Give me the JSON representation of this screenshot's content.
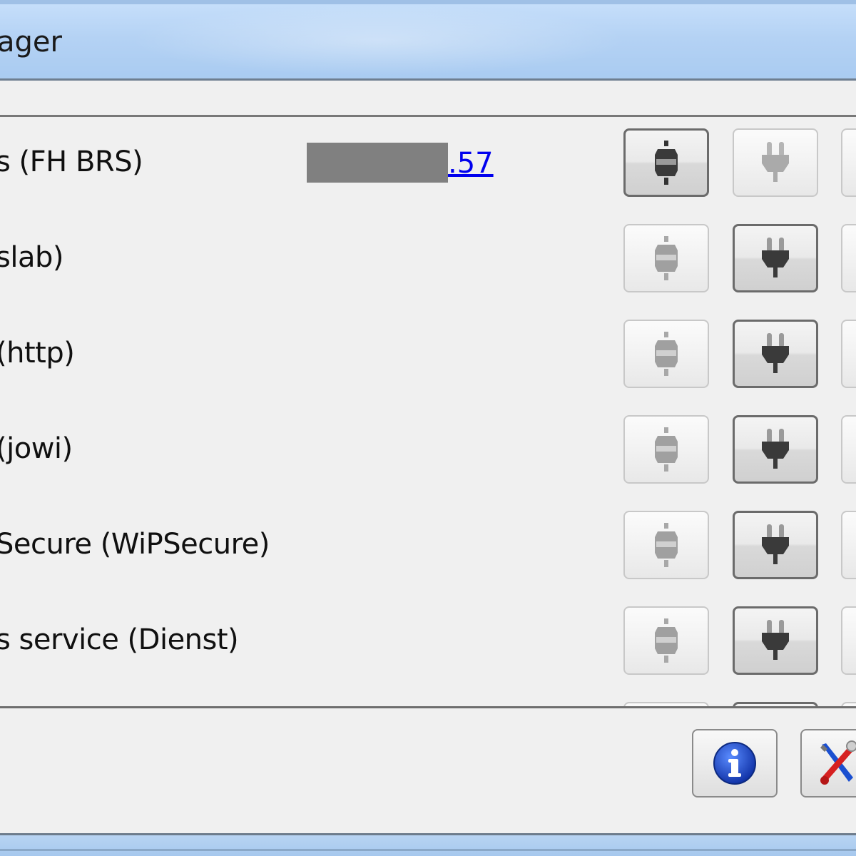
{
  "window": {
    "title": "ager"
  },
  "rows": [
    {
      "label": "s (FH BRS)",
      "ip_suffix": ".57",
      "state": "connected"
    },
    {
      "label": "slab)",
      "state": "disconnected"
    },
    {
      "label": "(http)",
      "state": "disconnected"
    },
    {
      "label": "(jowi)",
      "state": "disconnected"
    },
    {
      "label": "Secure (WiPSecure)",
      "state": "disconnected"
    },
    {
      "label": "s service (Dienst)",
      "state": "disconnected"
    }
  ],
  "icons": {
    "connected": "connected-plug-icon",
    "disconnected": "unplugged-icon",
    "info": "info-icon",
    "tools": "tools-icon"
  },
  "colors": {
    "titlebar": "#b4d2f4",
    "link": "#0000ee",
    "info_blue": "#1f4fd6",
    "tools_red": "#d62020"
  }
}
